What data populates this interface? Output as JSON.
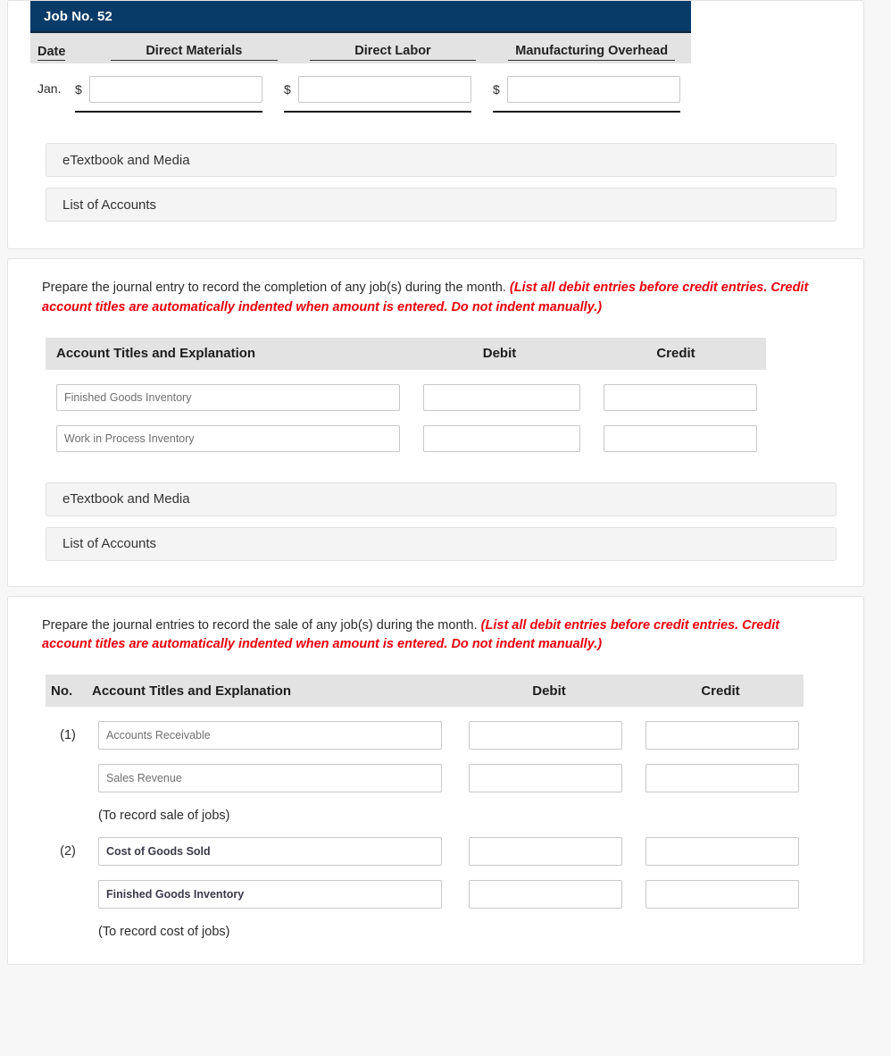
{
  "job_card": {
    "title": "Job No. 52",
    "columns": [
      "Date",
      "Direct Materials",
      "Direct Labor",
      "Manufacturing Overhead"
    ],
    "row": {
      "date": "Jan.",
      "currency_symbol": "$",
      "direct_materials": "",
      "direct_labor": "",
      "manufacturing_overhead": ""
    },
    "buttons": {
      "etextbook": "eTextbook and Media",
      "list_of_accounts": "List of Accounts"
    }
  },
  "completion_card": {
    "instruction_main": "Prepare the journal entry to record the completion of any job(s) during the month.",
    "instruction_hint": "(List all debit entries before credit entries. Credit account titles are automatically indented when amount is entered. Do not indent manually.)",
    "columns": {
      "account": "Account Titles and Explanation",
      "debit": "Debit",
      "credit": "Credit"
    },
    "rows": [
      {
        "account": "Finished Goods Inventory",
        "debit": "",
        "credit": ""
      },
      {
        "account": "Work in Process Inventory",
        "debit": "",
        "credit": ""
      }
    ],
    "buttons": {
      "etextbook": "eTextbook and Media",
      "list_of_accounts": "List of Accounts"
    }
  },
  "sale_card": {
    "instruction_main": "Prepare the journal entries to record the sale of any job(s) during the month.",
    "instruction_hint": "(List all debit entries before credit entries. Credit account titles are automatically indented when amount is entered. Do not indent manually.)",
    "columns": {
      "no": "No.",
      "account": "Account Titles and Explanation",
      "debit": "Debit",
      "credit": "Credit"
    },
    "entries": [
      {
        "no": "(1)",
        "rows": [
          {
            "account": "Accounts Receivable",
            "debit": "",
            "credit": ""
          },
          {
            "account": "Sales Revenue",
            "debit": "",
            "credit": ""
          }
        ],
        "note": "(To record sale of jobs)"
      },
      {
        "no": "(2)",
        "rows": [
          {
            "account": "Cost of Goods Sold",
            "debit": "",
            "credit": ""
          },
          {
            "account": "Finished Goods Inventory",
            "debit": "",
            "credit": ""
          }
        ],
        "note": "(To record cost of jobs)"
      }
    ]
  },
  "colors": {
    "header_navy": "#093b69",
    "col_header_gray": "#e3e3e3",
    "hint_red": "#e8000d",
    "button_gray": "#f4f4f4",
    "page_bg": "#f7f7f7"
  }
}
